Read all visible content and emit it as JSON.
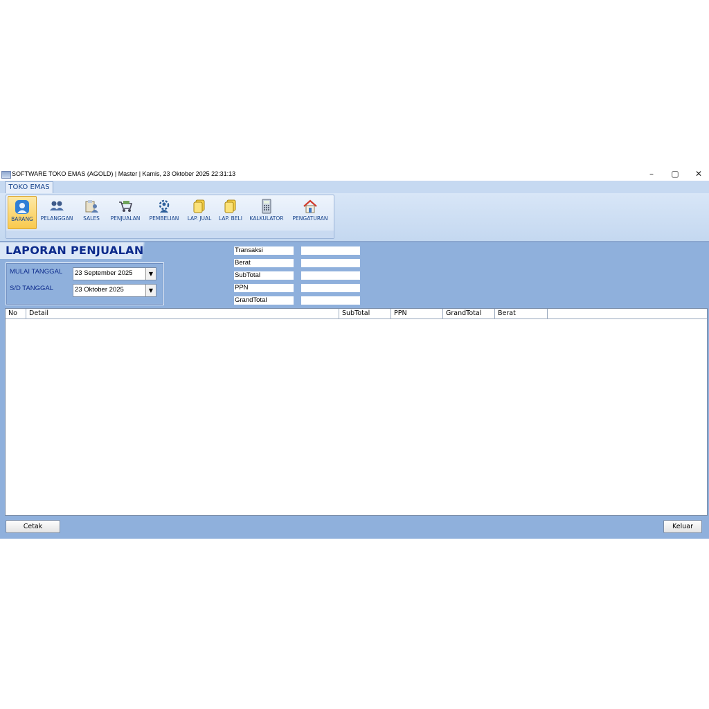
{
  "titlebar": {
    "title": "SOFTWARE TOKO EMAS (AGOLD) | Master | Kamis, 23 Oktober 2025 22:31:13",
    "minimize": "–",
    "maximize": "▢",
    "close": "✕"
  },
  "ribbon": {
    "tab": "TOKO EMAS",
    "buttons": [
      {
        "label": "BARANG",
        "icon": "user-icon"
      },
      {
        "label": "PELANGGAN",
        "icon": "users-icon"
      },
      {
        "label": "SALES",
        "icon": "clipboard-icon"
      },
      {
        "label": "PENJUALAN",
        "icon": "cart-icon"
      },
      {
        "label": "PEMBELIAN",
        "icon": "gear-person-icon"
      },
      {
        "label": "LAP. JUAL",
        "icon": "document-icon"
      },
      {
        "label": "LAP. BELI",
        "icon": "document-icon"
      },
      {
        "label": "KALKULATOR",
        "icon": "calculator-icon"
      },
      {
        "label": "PENGATURAN",
        "icon": "home-icon"
      }
    ]
  },
  "report": {
    "title": "LAPORAN PENJUALAN",
    "start_label": "MULAI TANGGAL",
    "start_value": "23 September 2025",
    "end_label": "S/D TANGGAL",
    "end_value": "23 Oktober 2025"
  },
  "summary": [
    {
      "label": "Transaksi",
      "value": ""
    },
    {
      "label": "Berat",
      "value": ""
    },
    {
      "label": "SubTotal",
      "value": ""
    },
    {
      "label": "PPN",
      "value": ""
    },
    {
      "label": "GrandTotal",
      "value": ""
    }
  ],
  "grid": {
    "columns": [
      "No",
      "Detail",
      "SubTotal",
      "PPN",
      "GrandTotal",
      "Berat"
    ],
    "rows": []
  },
  "buttons": {
    "print": "Cetak",
    "exit": "Keluar"
  },
  "colors": {
    "panel": "#8fb0dc",
    "title": "#0d2b8c"
  }
}
